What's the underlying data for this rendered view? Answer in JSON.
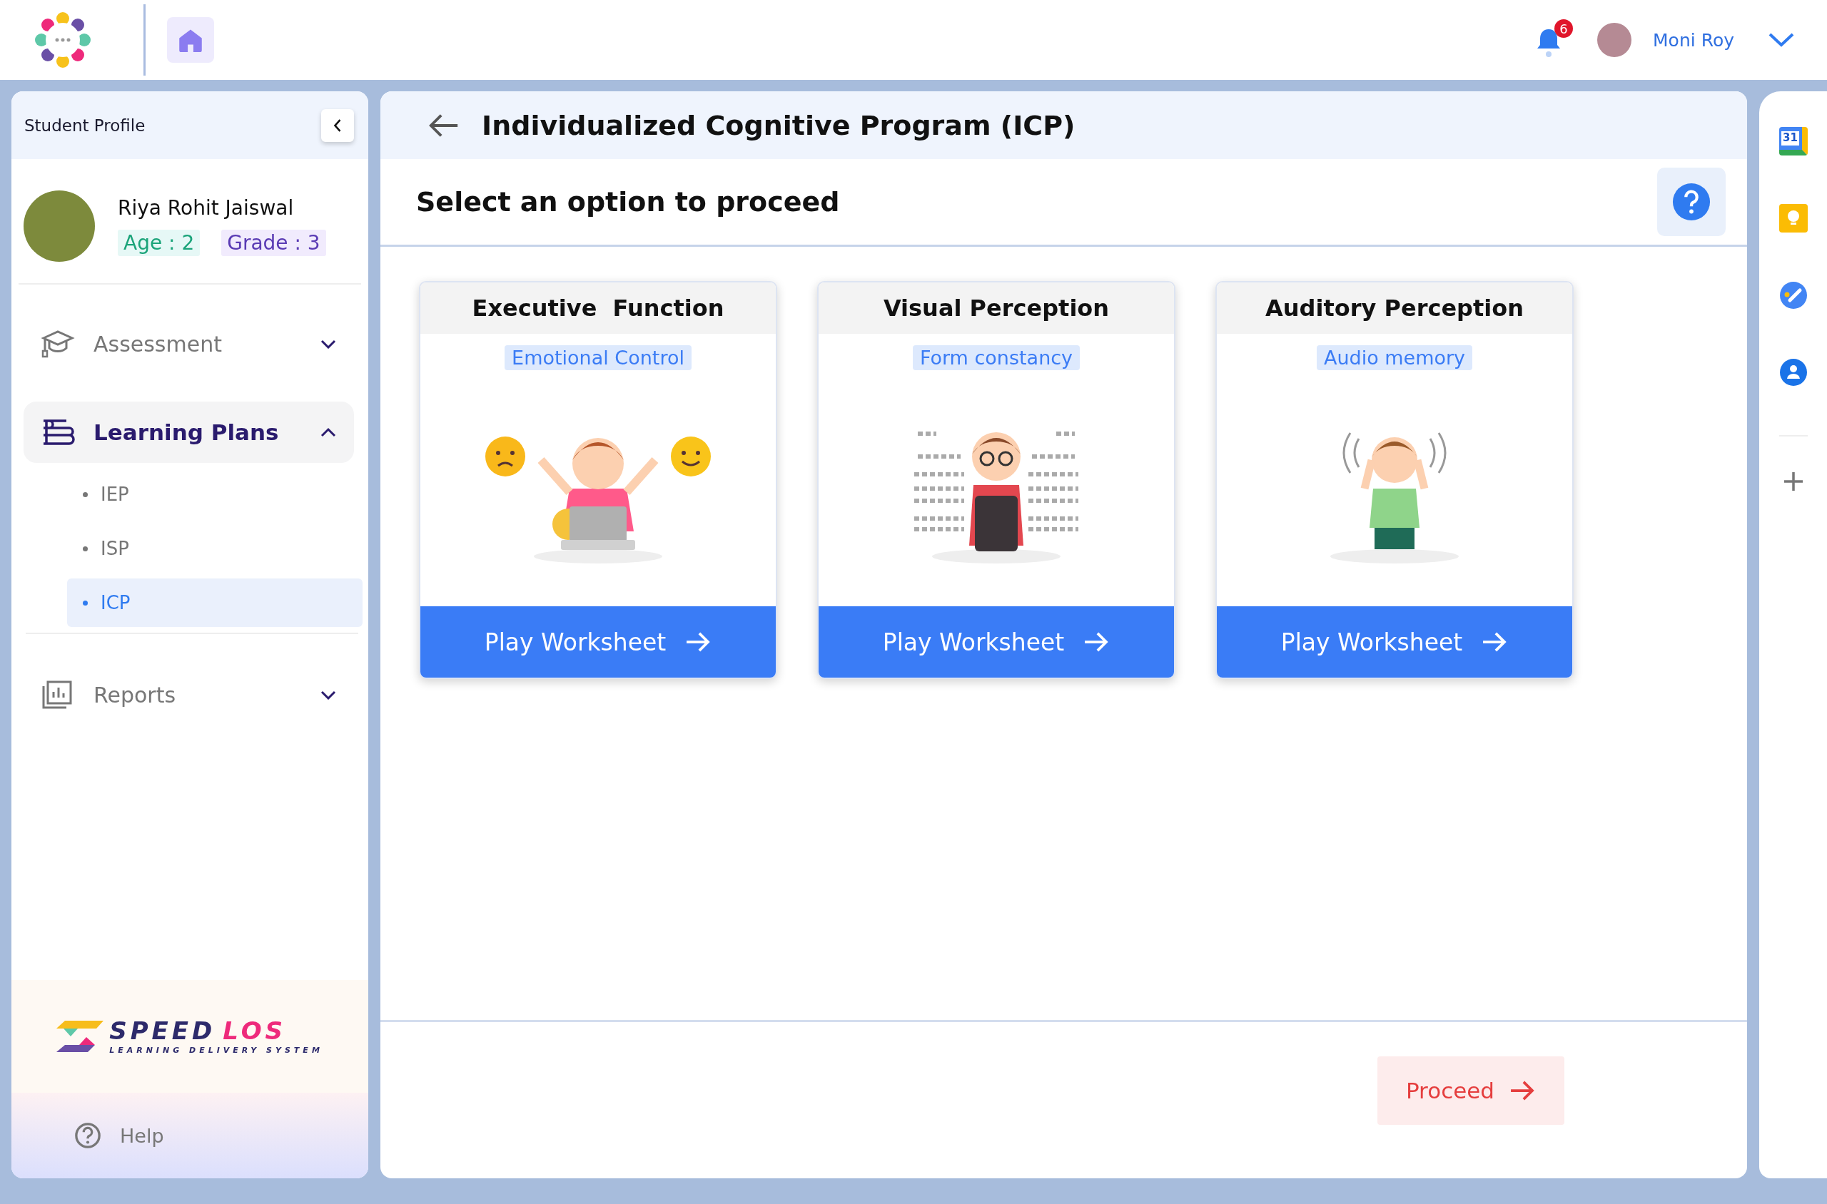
{
  "header": {
    "notification_count": "6",
    "user_name": "Moni Roy"
  },
  "sidebar": {
    "title": "Student Profile",
    "student": {
      "name": "Riya Rohit Jaiswal",
      "age": "Age : 2",
      "grade": "Grade : 3"
    },
    "items": [
      {
        "label": "Assessment",
        "kind": "assessment",
        "selected": false,
        "expanded": false
      },
      {
        "label": "Learning Plans",
        "kind": "plans",
        "selected": true,
        "expanded": true,
        "children": [
          {
            "label": "IEP",
            "selected": false
          },
          {
            "label": "ISP",
            "selected": false
          },
          {
            "label": "ICP",
            "selected": true
          }
        ]
      },
      {
        "label": "Reports",
        "kind": "reports",
        "selected": false,
        "expanded": false
      }
    ],
    "logo": {
      "brand_dark": "SPEED",
      "brand_accent": "LOS",
      "tagline": "LEARNING DELIVERY SYSTEM"
    },
    "help": "Help"
  },
  "main": {
    "title": "Individualized Cognitive Program (ICP)",
    "subtitle": "Select an option to proceed",
    "options": [
      {
        "title": "Executive  Function",
        "tag": "Emotional Control",
        "kind": "laptop",
        "button": "Play Worksheet"
      },
      {
        "title": "Visual Perception",
        "tag": "Form constancy",
        "kind": "eye-chart",
        "button": "Play Worksheet"
      },
      {
        "title": "Auditory Perception",
        "tag": "Audio memory",
        "kind": "ears",
        "button": "Play Worksheet"
      }
    ],
    "proceed": "Proceed"
  },
  "rail": {
    "calendar_day": "31"
  }
}
